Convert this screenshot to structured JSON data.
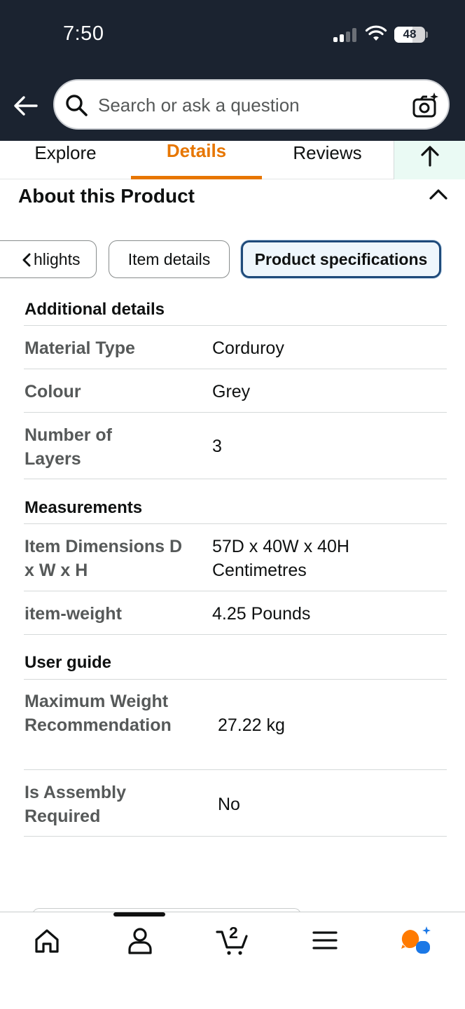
{
  "status_bar": {
    "time": "7:50",
    "battery": "48"
  },
  "search": {
    "placeholder": "Search or ask a question"
  },
  "tabs": [
    {
      "label": "Explore"
    },
    {
      "label": "Details",
      "active": true
    },
    {
      "label": "Reviews"
    }
  ],
  "section_header": "About this Product",
  "pills": [
    {
      "label": "Highlights",
      "visible_text": "hlights"
    },
    {
      "label": "Item details"
    },
    {
      "label": "Product specifications",
      "selected": true
    }
  ],
  "specs": {
    "additional": {
      "title": "Additional details",
      "rows": [
        {
          "label": "Material Type",
          "value": "Corduroy"
        },
        {
          "label": "Colour",
          "value": "Grey"
        },
        {
          "label": "Number of Layers",
          "value": "3"
        }
      ]
    },
    "measurements": {
      "title": "Measurements",
      "rows": [
        {
          "label": "Item Dimensions D x W x H",
          "value": "57D x 40W x 40H Centimetres"
        },
        {
          "label": "item-weight",
          "value": "4.25 Pounds"
        }
      ]
    },
    "user_guide": {
      "title": "User guide",
      "rows": [
        {
          "label": "Maximum Weight Recommendation",
          "value": "27.22 kg"
        },
        {
          "label": "Is Assembly Required",
          "value": "No"
        }
      ]
    }
  },
  "bottom_nav": {
    "cart_count": "2",
    "items": [
      "home-icon",
      "account-icon",
      "cart-icon",
      "menu-icon",
      "rufus-ai-icon"
    ]
  },
  "colors": {
    "header_bg": "#1b2330",
    "accent_orange": "#e77600",
    "selected_pill_border": "#1e4a7a"
  }
}
